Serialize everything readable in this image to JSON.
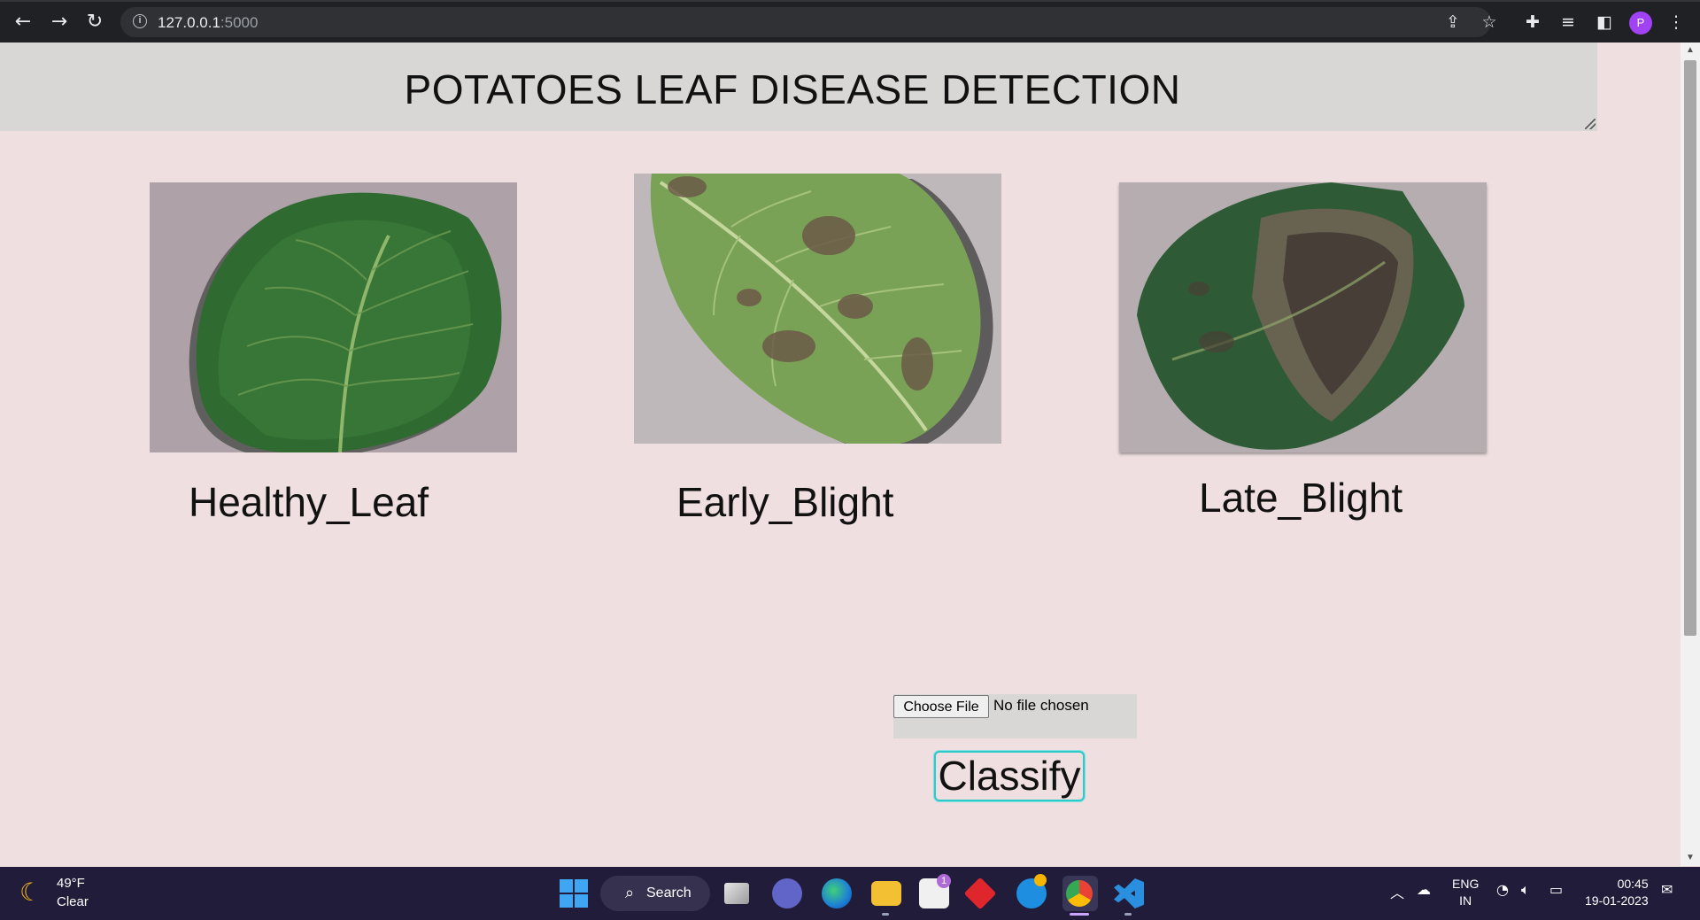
{
  "browser": {
    "url_host": "127.0.0.1",
    "url_port": ":5000",
    "profile_initial": "P"
  },
  "page": {
    "title": "POTATOES LEAF DISEASE DETECTION",
    "leaves": [
      {
        "label": "Healthy_Leaf"
      },
      {
        "label": "Early_Blight"
      },
      {
        "label": "Late_Blight"
      }
    ],
    "file_input": {
      "button_label": "Choose File",
      "status": "No file chosen"
    },
    "classify_label": "Classify"
  },
  "taskbar": {
    "weather": {
      "temp": "49°F",
      "condition": "Clear"
    },
    "search_label": "Search",
    "store_badge": "1",
    "language": {
      "line1": "ENG",
      "line2": "IN"
    },
    "clock": {
      "time": "00:45",
      "date": "19-01-2023"
    }
  },
  "colors": {
    "page_bg": "#efdfe0",
    "header_bg": "#d9d6d6",
    "classify_border": "#2fc9c9",
    "taskbar_bg": "#201c3a"
  }
}
